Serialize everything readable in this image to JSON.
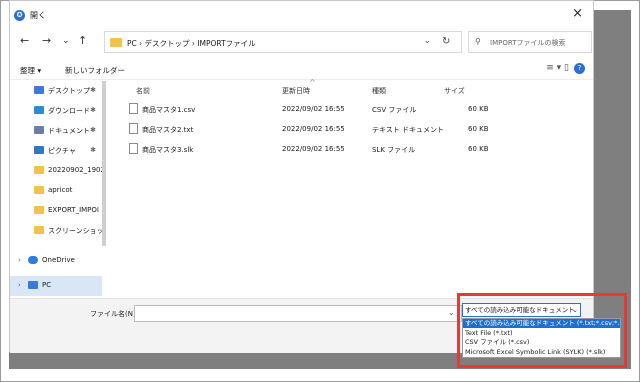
{
  "window": {
    "title": "開く",
    "close": "×"
  },
  "nav": {
    "back": "←",
    "forward": "→",
    "recent": "⌄",
    "up": "↑",
    "refresh": "↻"
  },
  "address": {
    "path": "PC  ›  デスクトップ  ›  IMPORTファイル",
    "prefix": "›",
    "dropdown": "⌄"
  },
  "search": {
    "placeholder": "IMPORTファイルの検索",
    "icon": "⚲"
  },
  "toolbar": {
    "organize": "整理 ▾",
    "new_folder": "新しいフォルダー",
    "view": "≡ ▾   ▯"
  },
  "sidebar": {
    "items": [
      {
        "label": "デスクトップ",
        "pin": "✱",
        "color": "#3f7ad9"
      },
      {
        "label": "ダウンロード",
        "pin": "✱",
        "color": "#2c8bd6"
      },
      {
        "label": "ドキュメント",
        "pin": "✱",
        "color": "#6b7fa6"
      },
      {
        "label": "ピクチャ",
        "pin": "✱",
        "color": "#2f78c4"
      },
      {
        "label": "20220902_1902",
        "pin": "",
        "color": "#f2c14e"
      },
      {
        "label": "apricot",
        "pin": "",
        "color": "#f2c14e"
      },
      {
        "label": "EXPORT_IMPOI",
        "pin": "",
        "color": "#f2c14e"
      },
      {
        "label": "スクリーンショット",
        "pin": "",
        "color": "#f2c14e"
      },
      {
        "label": "OneDrive",
        "pin": "",
        "color": "#2f7de0",
        "expander": "›"
      },
      {
        "label": "PC",
        "pin": "",
        "color": "#3d7ad6",
        "expander": "›"
      }
    ]
  },
  "columns": {
    "name": "名前",
    "date": "更新日時",
    "type": "種類",
    "size": "サイズ",
    "sort": "^"
  },
  "files": [
    {
      "name": "商品マスタ1.csv",
      "date": "2022/09/02 16:55",
      "type": "CSV ファイル",
      "size": "60 KB"
    },
    {
      "name": "商品マスタ2.txt",
      "date": "2022/09/02 16:55",
      "type": "テキスト ドキュメント",
      "size": "60 KB"
    },
    {
      "name": "商品マスタ3.slk",
      "date": "2022/09/02 16:55",
      "type": "SLK ファイル",
      "size": "60 KB"
    }
  ],
  "footer": {
    "filename_label": "ファイル名(N):",
    "filename_value": "",
    "filename_chev": "⌄",
    "filetype_selected": "すべての読み込み可能なドキュメント",
    "filetype_chev": "⌄",
    "filetype_options": [
      "すべての読み込み可能なドキュメント (*.txt;*.csv;*.slk)",
      "Text File (*.txt)",
      "CSV ファイル (*.csv)",
      "Microsoft Excel Symbolic Link (SYLK) (*.slk)"
    ]
  },
  "colors": {
    "accent": "#1f6fd1",
    "highlight": "#e23b3b",
    "backdrop": "#7f7f7f"
  }
}
